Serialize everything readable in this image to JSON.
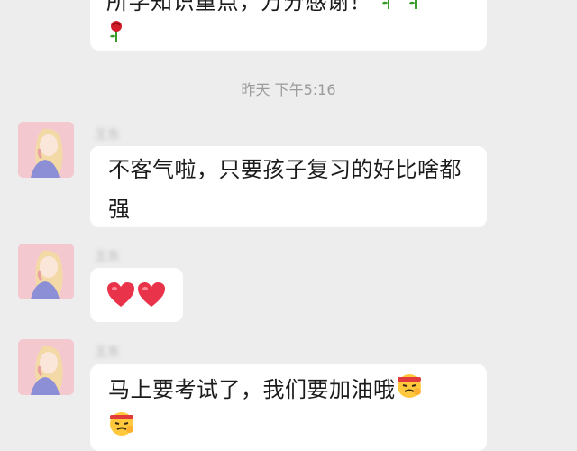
{
  "messages": [
    {
      "id": "m0",
      "direction": "incoming",
      "text": "所学知识重点，万分感谢！",
      "trailing_emojis": [
        "rose-icon",
        "rose-icon",
        "rose-icon"
      ]
    },
    {
      "id": "m1",
      "direction": "incoming",
      "sender": "王东",
      "text": "不客气啦，只要孩子复习的好比啥都强"
    },
    {
      "id": "m2",
      "direction": "incoming",
      "sender": "王东",
      "emojis": [
        "heart-icon",
        "heart-icon"
      ]
    },
    {
      "id": "m3",
      "direction": "incoming",
      "sender": "王东",
      "text": "马上要考试了，我们要加油哦",
      "trailing_emojis": [
        "determined-face-icon",
        "determined-face-icon"
      ]
    }
  ],
  "timestamp": "昨天 下午5:16",
  "colors": {
    "background": "#ededed",
    "bubble": "#ffffff",
    "timestamp": "#9b9b9b",
    "avatar_bg": "#f4c8cf"
  }
}
